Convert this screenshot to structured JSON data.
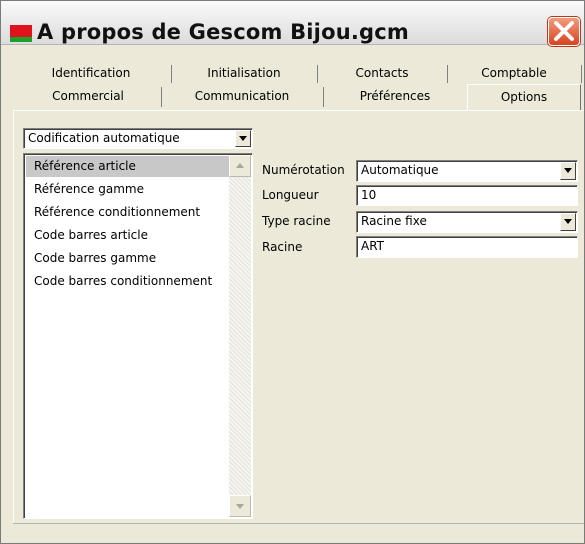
{
  "window": {
    "title": "A propos de Gescom Bijou.gcm"
  },
  "tabs": {
    "row1": [
      "Identification",
      "Initialisation",
      "Contacts",
      "Comptable"
    ],
    "row2": [
      "Commercial",
      "Communication",
      "Préférences",
      "Options"
    ],
    "active": "Options"
  },
  "options": {
    "category_select": "Codification automatique",
    "list_items": [
      "Référence article",
      "Référence gamme",
      "Référence conditionnement",
      "Code barres article",
      "Code barres gamme",
      "Code barres conditionnement"
    ],
    "selected_item": "Référence article",
    "fields": {
      "numerotation": {
        "label": "Numérotation",
        "value": "Automatique"
      },
      "longueur": {
        "label": "Longueur",
        "value": "10"
      },
      "type_racine": {
        "label": "Type racine",
        "value": "Racine fixe"
      },
      "racine": {
        "label": "Racine",
        "value": "ART"
      }
    }
  },
  "colors": {
    "close_button": "#d8431f",
    "selection": "#c8c8c8",
    "dialog": "#ece9d8"
  },
  "icons": {
    "app": "gescom-app-icon",
    "close": "close-icon"
  }
}
